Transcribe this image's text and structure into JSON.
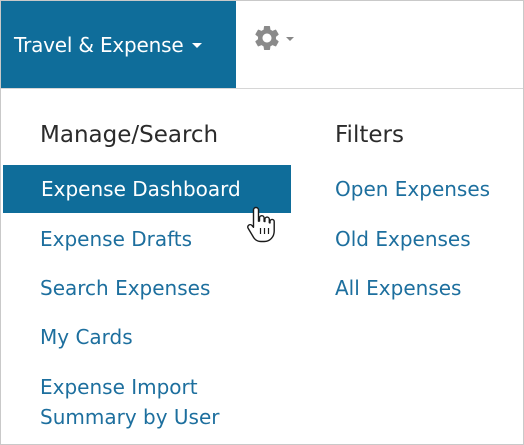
{
  "nav": {
    "module_label": "Travel & Expense"
  },
  "settings": {
    "icon": "gear-icon"
  },
  "menu": {
    "columns": [
      {
        "heading": "Manage/Search",
        "items": [
          {
            "label": "Expense Dashboard",
            "highlighted": true
          },
          {
            "label": "Expense Drafts"
          },
          {
            "label": "Search Expenses"
          },
          {
            "label": "My Cards"
          },
          {
            "label": "Expense Import Summary by User"
          }
        ]
      },
      {
        "heading": "Filters",
        "items": [
          {
            "label": "Open Expenses"
          },
          {
            "label": "Old Expenses"
          },
          {
            "label": "All Expenses"
          }
        ]
      }
    ]
  },
  "colors": {
    "brand": "#0f6d9a",
    "link": "#1d6f9e",
    "heading": "#2b2b2b"
  },
  "cursor": {
    "icon": "hand-pointer-icon"
  }
}
